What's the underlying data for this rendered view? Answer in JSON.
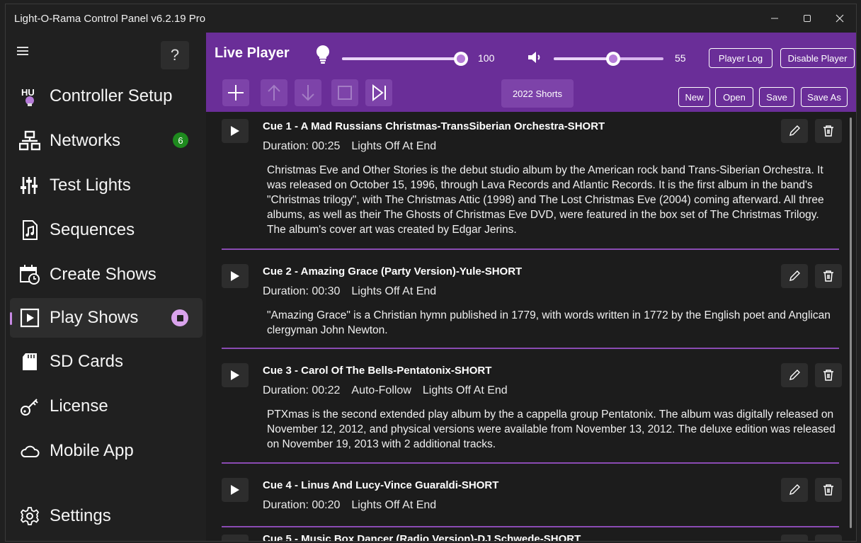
{
  "window": {
    "title": "Light-O-Rama Control Panel v6.2.19 Pro",
    "controls": [
      "minimize",
      "maximize",
      "close"
    ]
  },
  "sidebar": {
    "help_label": "?",
    "items": [
      {
        "label": "Controller Setup",
        "icon": "controller-setup-icon"
      },
      {
        "label": "Networks",
        "icon": "network-icon",
        "badge": "6"
      },
      {
        "label": "Test Lights",
        "icon": "sliders-icon"
      },
      {
        "label": "Sequences",
        "icon": "music-file-icon"
      },
      {
        "label": "Create Shows",
        "icon": "calendar-clock-icon"
      },
      {
        "label": "Play Shows",
        "icon": "play-box-icon",
        "active": true
      },
      {
        "label": "SD Cards",
        "icon": "sd-card-icon"
      },
      {
        "label": "License",
        "icon": "key-icon"
      },
      {
        "label": "Mobile App",
        "icon": "cloud-icon"
      },
      {
        "label": "Settings",
        "icon": "gear-icon"
      }
    ]
  },
  "player": {
    "title": "Live Player",
    "brightness_value": "100",
    "brightness_level": 1.0,
    "volume_value": "55",
    "volume_level": 0.55,
    "player_log_label": "Player Log",
    "disable_player_label": "Disable Player",
    "playlist_label": "2022 Shorts",
    "new_label": "New",
    "open_label": "Open",
    "save_label": "Save",
    "save_as_label": "Save As"
  },
  "cues": [
    {
      "title": "Cue 1 - A Mad Russians Christmas-TransSiberian Orchestra-SHORT",
      "duration": "Duration: 00:25",
      "flags": "Lights Off At End",
      "description": "Christmas Eve and Other Stories is the debut studio album by the American rock band Trans-Siberian Orchestra. It was released on October 15, 1996, through Lava Records and Atlantic Records. It is the first album in the band's \"Christmas trilogy\", with The Christmas Attic (1998) and The Lost Christmas Eve (2004) coming afterward. All three albums, as well as their The Ghosts of Christmas Eve DVD, were featured in the box set of The Christmas Trilogy. The album's cover art was created by Edgar Jerins."
    },
    {
      "title": "Cue 2 - Amazing Grace (Party Version)-Yule-SHORT",
      "duration": "Duration: 00:30",
      "flags": "Lights Off At End",
      "description": "\"Amazing Grace\" is a Christian hymn published in 1779, with words written in 1772 by the English poet and Anglican clergyman John Newton."
    },
    {
      "title": "Cue 3 - Carol Of The Bells-Pentatonix-SHORT",
      "duration": "Duration: 00:22",
      "flags": "Auto-Follow",
      "flags2": "Lights Off At End",
      "description": "PTXmas is the second extended play album by the a cappella group Pentatonix. The album was digitally released on November 12, 2012, and physical versions were available from November 13, 2012. The deluxe edition was released on November 19, 2013 with 2 additional tracks."
    },
    {
      "title": "Cue 4 - Linus And Lucy-Vince Guaraldi-SHORT",
      "duration": "Duration: 00:20",
      "flags": "Lights Off At End",
      "description": ""
    },
    {
      "title": "Cue 5 - Music Box Dancer (Radio Version)-DJ Schwede-SHORT",
      "duration": "",
      "flags": "",
      "description": ""
    }
  ],
  "colors": {
    "accent": "#6a2e98",
    "accent_light": "#c88ae4",
    "badge_green": "#1e8a1e",
    "background": "#1c1c1c"
  }
}
